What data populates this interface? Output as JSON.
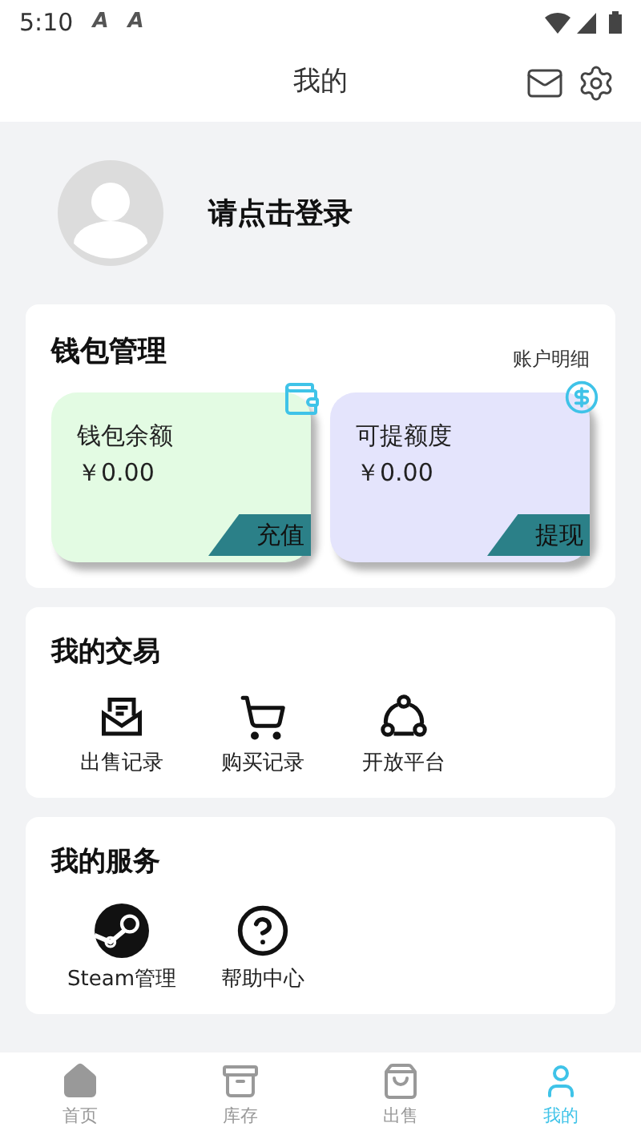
{
  "status_bar": {
    "time": "5:10",
    "notification_icons": [
      "A",
      "A"
    ]
  },
  "header": {
    "title": "我的"
  },
  "profile": {
    "login_prompt": "请点击登录"
  },
  "wallet": {
    "title": "钱包管理",
    "link": "账户明细",
    "cards": [
      {
        "kind": "wallet",
        "label": "钱包余额",
        "amount": "￥0.00",
        "action": "充值",
        "color": "#e3fbe3"
      },
      {
        "kind": "withdraw",
        "label": "可提额度",
        "amount": "￥0.00",
        "action": "提现",
        "color": "#e4e4fc"
      }
    ]
  },
  "trades": {
    "title": "我的交易",
    "items": [
      {
        "kind": "sales",
        "label": "出售记录"
      },
      {
        "kind": "cart",
        "label": "购买记录"
      },
      {
        "kind": "share",
        "label": "开放平台"
      }
    ]
  },
  "services": {
    "title": "我的服务",
    "items": [
      {
        "kind": "steam",
        "label": "Steam管理"
      },
      {
        "kind": "help",
        "label": "帮助中心"
      }
    ]
  },
  "tab_bar": [
    {
      "kind": "home",
      "label": "首页",
      "selected": false
    },
    {
      "kind": "box",
      "label": "库存",
      "selected": false
    },
    {
      "kind": "bag",
      "label": "出售",
      "selected": false
    },
    {
      "kind": "user",
      "label": "我的",
      "selected": true
    }
  ]
}
